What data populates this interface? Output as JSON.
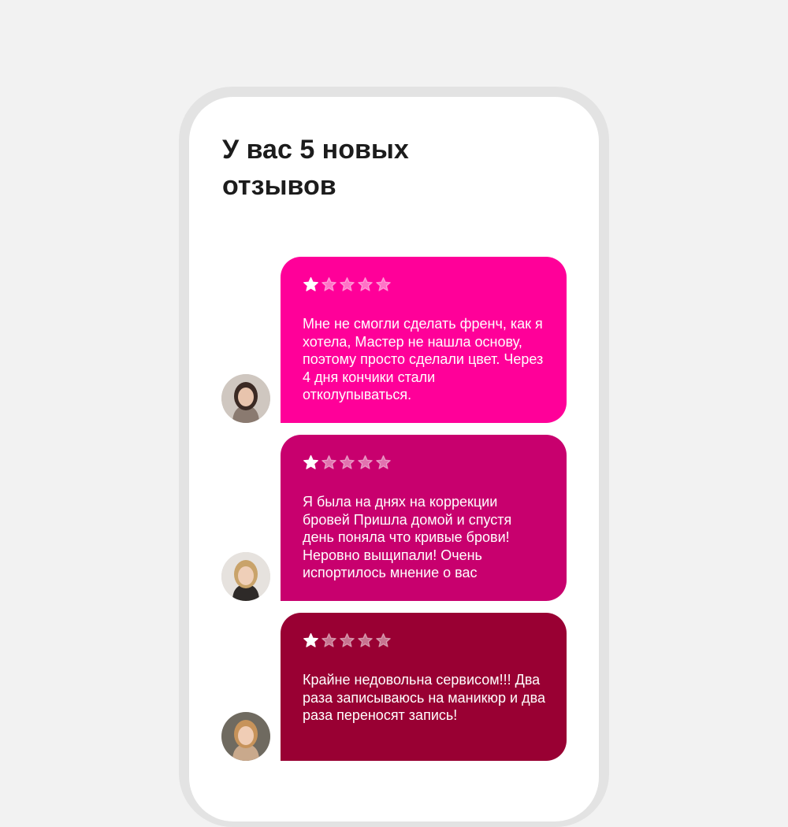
{
  "header": {
    "title": "У вас 5 новых отзывов"
  },
  "reviews": [
    {
      "rating": 1,
      "max_rating": 5,
      "color": "#ff0099",
      "text": "Мне не смогли сделать френч, как я хотела, Мастер не нашла основу, поэтому просто сделали цвет. Через 4 дня кончики стали отколупываться.",
      "avatar_icon": "avatar-woman-dark-hair"
    },
    {
      "rating": 1,
      "max_rating": 5,
      "color": "#c8006e",
      "text": "Я была на днях на коррекции бровей Пришла домой и спустя день поняла что кривые брови! Неровно выщипали! Очень испортилось мнение о вас",
      "avatar_icon": "avatar-woman-blonde"
    },
    {
      "rating": 1,
      "max_rating": 5,
      "color": "#990033",
      "text": "Крайне недовольна сервисом!!! Два раза записываюсь на маникюр и два раза переносят запись!",
      "avatar_icon": "avatar-woman-light-hair"
    }
  ],
  "colors": {
    "background": "#f2f2f2",
    "phone_frame": "#e3e3e3",
    "screen": "#ffffff",
    "title": "#1c1c1c",
    "star_filled": "#ffffff"
  }
}
